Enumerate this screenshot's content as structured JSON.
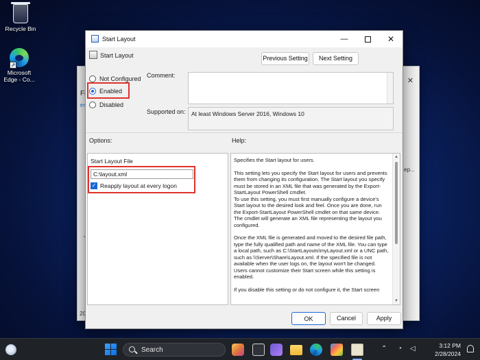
{
  "desktop": {
    "recycle_bin_label": "Recycle Bin",
    "edge_label": "Microsoft Edge - Co..."
  },
  "background_window": {
    "menu_fragment": "Fi",
    "side_text": "ep...",
    "status_fragment": "20"
  },
  "dialog": {
    "window_title": "Start Layout",
    "policy_title": "Start Layout",
    "previous_setting_label": "Previous Setting",
    "next_setting_label": "Next Setting",
    "radio_options": [
      {
        "label": "Not Configured",
        "selected": false
      },
      {
        "label": "Enabled",
        "selected": true
      },
      {
        "label": "Disabled",
        "selected": false
      }
    ],
    "comment_label": "Comment:",
    "comment_value": "",
    "supported_on_label": "Supported on:",
    "supported_on_value": "At least Windows Server 2016, Windows 10",
    "options_label": "Options:",
    "help_label": "Help:",
    "options": {
      "file_label": "Start Layout File",
      "file_value": "C:\\layout.xml",
      "reapply_label": "Reapply layout at every logon",
      "reapply_checked": true
    },
    "help_paragraphs": [
      "Specifies the Start layout for users.",
      "This setting lets you specify the Start layout for users and prevents them from changing its configuration. The Start layout you specify must be stored in an XML file that was generated by the Export-StartLayout PowerShell cmdlet.",
      "To use this setting, you must first manually configure a device's Start layout to the desired look and feel. Once you are done, run the Export-StartLayout PowerShell cmdlet on that same device. The cmdlet will generate an XML file representing the layout you configured.",
      "Once the XML file is generated and moved to the desired file path, type the fully qualified path and name of the XML file. You can type a local path, such as C:\\StartLayouts\\myLayout.xml or a UNC path, such as \\\\Server\\Share\\Layout.xml. If the specified file is not available when the user logs on, the layout won't be changed. Users cannot customize their Start screen while this setting is enabled.",
      "If you disable this setting or do not configure it, the Start screen"
    ],
    "ok_label": "OK",
    "cancel_label": "Cancel",
    "apply_label": "Apply"
  },
  "taskbar": {
    "search_placeholder": "Search",
    "time": "3:12 PM",
    "date": "2/28/2024"
  },
  "colors": {
    "highlight": "#e0312b",
    "accent": "#1a66d6"
  }
}
